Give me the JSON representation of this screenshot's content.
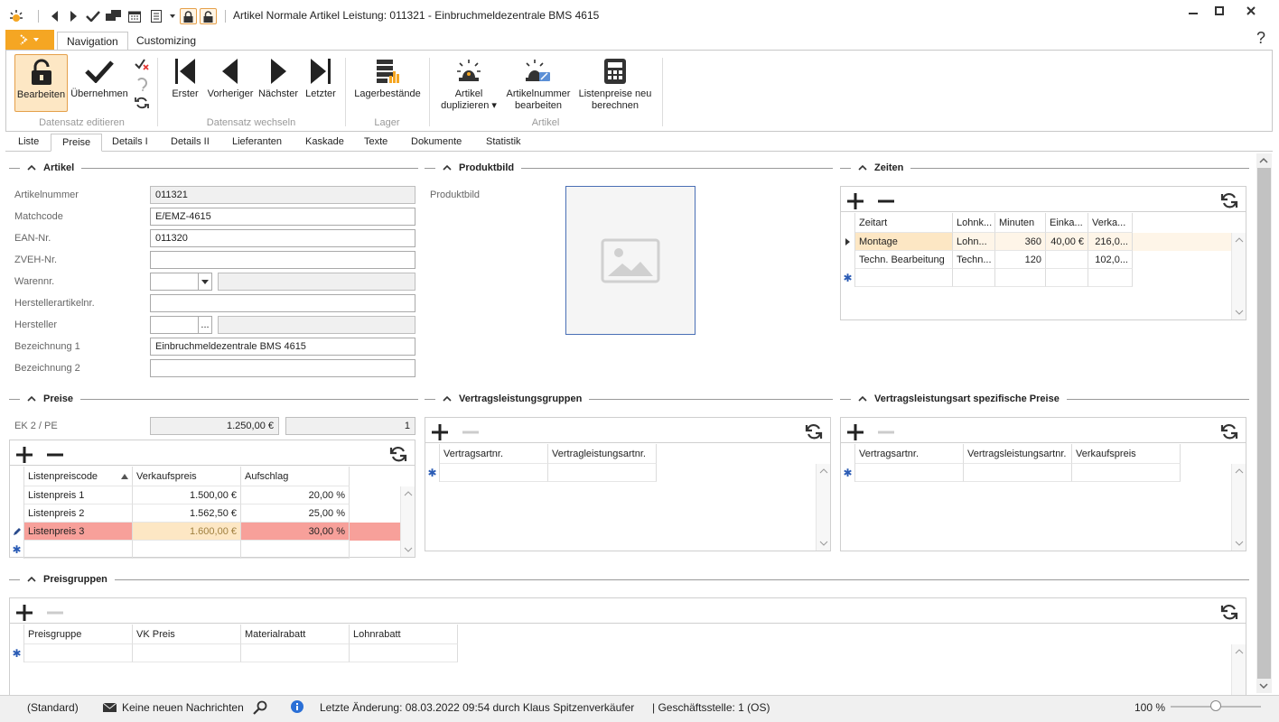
{
  "window": {
    "title": "Artikel Normale Artikel Leistung: 011321 - Einbruchmeldezentrale BMS 4615"
  },
  "ribbon_tabs": [
    "Navigation",
    "Customizing"
  ],
  "help": "?",
  "ribbon": {
    "edit": "Bearbeiten",
    "accept": "Übernehmen",
    "group1": "Datensatz editieren",
    "first": "Erster",
    "prev": "Vorheriger",
    "next": "Nächster",
    "last": "Letzter",
    "group2": "Datensatz wechseln",
    "stock": "Lagerbestände",
    "group3": "Lager",
    "dup1": "Artikel",
    "dup2": "duplizieren ▾",
    "artnr1": "Artikelnummer",
    "artnr2": "bearbeiten",
    "lp1": "Listenpreise neu",
    "lp2": "berechnen",
    "group4": "Artikel"
  },
  "page_tabs": [
    "Liste",
    "Preise",
    "Details I",
    "Details II",
    "Lieferanten",
    "Kaskade",
    "Texte",
    "Dokumente",
    "Statistik"
  ],
  "artikel": {
    "title": "Artikel",
    "labels": [
      "Artikelnummer",
      "Matchcode",
      "EAN-Nr.",
      "ZVEH-Nr.",
      "Warennr.",
      "Herstellerartikelnr.",
      "Hersteller",
      "Bezeichnung 1",
      "Bezeichnung 2"
    ],
    "artikelnummer": "011321",
    "matchcode": "E/EMZ-4615",
    "ean": "011320",
    "zveh": "",
    "warennr": "",
    "herstellerartnr": "",
    "hersteller": "",
    "bez1": "Einbruchmeldezentrale BMS 4615",
    "bez2": "",
    "ellipsis": "..."
  },
  "produktbild": {
    "title": "Produktbild",
    "label": "Produktbild"
  },
  "zeiten": {
    "title": "Zeiten",
    "headers": [
      "Zeitart",
      "Lohnk...",
      "Minuten",
      "Einka...",
      "Verka..."
    ],
    "rows": [
      [
        "Montage",
        "Lohn...",
        "360",
        "40,00 €",
        "216,0..."
      ],
      [
        "Techn. Bearbeitung",
        "Techn...",
        "120",
        "",
        "102,0..."
      ]
    ]
  },
  "preise": {
    "title": "Preise",
    "ek_label": "EK 2 / PE",
    "ek_value": "1.250,00 €",
    "pe_value": "1",
    "headers": [
      "Listenpreiscode",
      "Verkaufspreis",
      "Aufschlag"
    ],
    "rows": [
      [
        "Listenpreis 1",
        "1.500,00 €",
        "20,00 %"
      ],
      [
        "Listenpreis 2",
        "1.562,50 €",
        "25,00 %"
      ],
      [
        "Listenpreis 3",
        "1.600,00 €",
        "30,00 %"
      ]
    ]
  },
  "vlg": {
    "title": "Vertragsleistungsgruppen",
    "headers": [
      "Vertragsartnr.",
      "Vertragleistungsartnr."
    ]
  },
  "vlsp": {
    "title": "Vertragsleistungsart spezifische Preise",
    "headers": [
      "Vertragsartnr.",
      "Vertragsleistungsartnr.",
      "Verkaufspreis"
    ]
  },
  "preisgruppen": {
    "title": "Preisgruppen",
    "headers": [
      "Preisgruppe",
      "VK Preis",
      "Materialrabatt",
      "Lohnrabatt"
    ]
  },
  "status": {
    "layout": "(Standard)",
    "messages": "Keine neuen Nachrichten",
    "change": "Letzte Änderung: 08.03.2022 09:54 durch Klaus Spitzenverkäufer",
    "branch": "| Geschäftsstelle:  1 (OS)",
    "zoom": "100 %"
  },
  "colors": {
    "accent": "#f5a623",
    "selected_row": "#fde7c4",
    "error_row": "#f7a09a"
  }
}
